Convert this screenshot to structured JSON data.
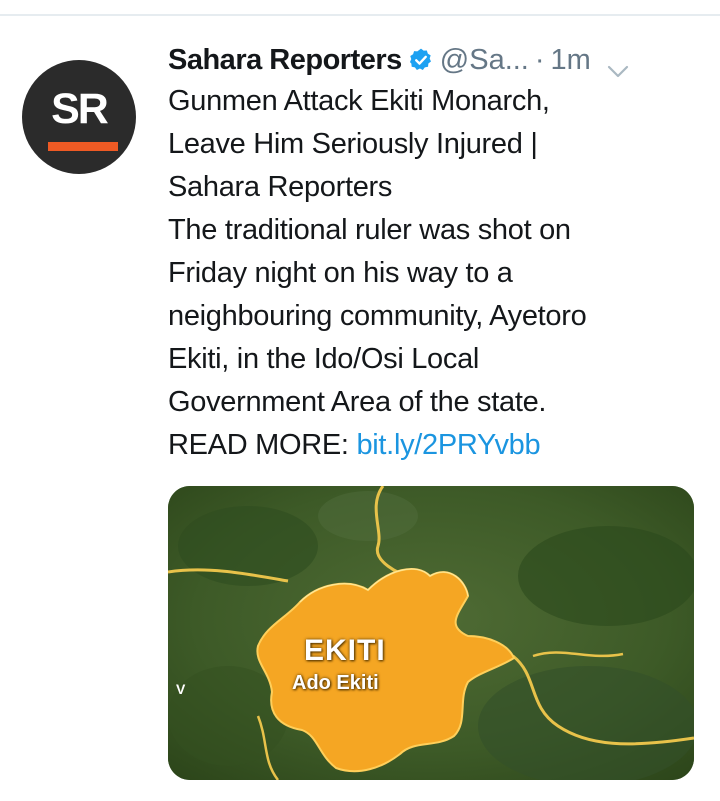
{
  "tweet": {
    "avatar_text": "SR",
    "display_name": "Sahara Reporters",
    "handle": "@Sa...",
    "separator": "·",
    "timestamp": "1m",
    "title_lines": [
      "Gunmen Attack Ekiti Monarch,",
      "Leave Him Seriously Injured |",
      "Sahara Reporters"
    ],
    "body_lines": [
      "The traditional ruler was shot on",
      "Friday night on his way to a",
      "neighbouring community, Ayetoro",
      "Ekiti, in the Ido/Osi Local",
      "Government Area of the state."
    ],
    "read_more_label": "READ MORE:",
    "link_text": "bit.ly/2PRYvbb",
    "media": {
      "state_label": "EKITI",
      "capital_label": "Ado Ekiti",
      "edge_letter": "V"
    }
  },
  "colors": {
    "brand_orange": "#ee5a24",
    "link_blue": "#1b95e0",
    "verified_blue": "#1da1f2",
    "muted_gray": "#657786",
    "map_highlight": "#f5a623"
  },
  "icons": [
    "verified-badge-icon",
    "chevron-down-icon"
  ]
}
